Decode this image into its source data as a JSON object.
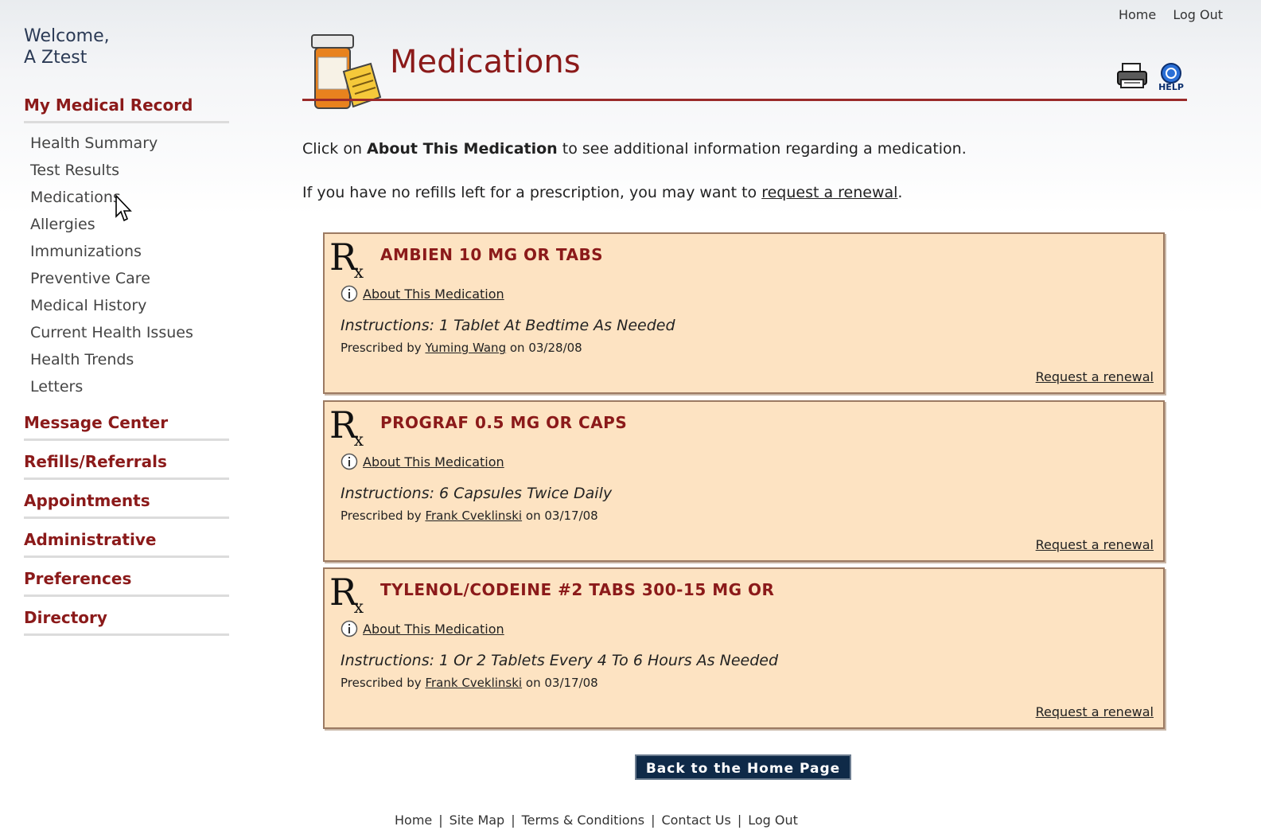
{
  "header": {
    "top_links": [
      "Home",
      "Log Out"
    ],
    "page_title": "Medications",
    "icons": [
      "printer-icon",
      "help-icon"
    ],
    "help_label": "HELP"
  },
  "sidebar": {
    "welcome_line1": "Welcome,",
    "welcome_line2": "A Ztest",
    "sections": [
      {
        "label": "My Medical Record",
        "items": [
          "Health Summary",
          "Test Results",
          "Medications",
          "Allergies",
          "Immunizations",
          "Preventive Care",
          "Medical History",
          "Current Health Issues",
          "Health Trends",
          "Letters"
        ]
      },
      {
        "label": "Message Center"
      },
      {
        "label": "Refills/Referrals"
      },
      {
        "label": "Appointments"
      },
      {
        "label": "Administrative"
      },
      {
        "label": "Preferences"
      },
      {
        "label": "Directory"
      }
    ]
  },
  "intro": {
    "line1_pre": "Click on ",
    "line1_bold": "About This Medication",
    "line1_post": " to see additional information regarding a medication.",
    "line2_pre": "If you have no refills left for a prescription, you may want to ",
    "line2_link": "request a renewal",
    "line2_post": "."
  },
  "medications": [
    {
      "name": "AMBIEN 10 MG OR TABS",
      "about_label": "About This Medication",
      "instructions": "Instructions: 1 Tablet At Bedtime As Needed",
      "prescribed_prefix": "Prescribed by",
      "prescriber": "Yuming Wang",
      "on_label": "on",
      "date": "03/28/08",
      "renew_label": "Request a renewal"
    },
    {
      "name": "PROGRAF 0.5 MG OR CAPS",
      "about_label": "About This Medication",
      "instructions": "Instructions: 6 Capsules Twice Daily",
      "prescribed_prefix": "Prescribed by",
      "prescriber": "Frank Cveklinski",
      "on_label": "on",
      "date": "03/17/08",
      "renew_label": "Request a renewal"
    },
    {
      "name": "TYLENOL/CODEINE #2 TABS 300-15 MG OR",
      "about_label": "About This Medication",
      "instructions": "Instructions: 1 Or 2 Tablets Every 4 To 6 Hours As Needed",
      "prescribed_prefix": "Prescribed by",
      "prescriber": "Frank Cveklinski",
      "on_label": "on",
      "date": "03/17/08",
      "renew_label": "Request a renewal"
    }
  ],
  "rx_symbol": {
    "r": "R",
    "x": "x"
  },
  "back_button": "Back to the Home Page",
  "footer": {
    "links": [
      "Home",
      "Site Map",
      "Terms & Conditions",
      "Contact Us",
      "Log Out"
    ],
    "separator": "|"
  },
  "colors": {
    "accent": "#8b1a1a",
    "card_bg": "#fde3c2",
    "button_bg": "#0f2a48"
  }
}
